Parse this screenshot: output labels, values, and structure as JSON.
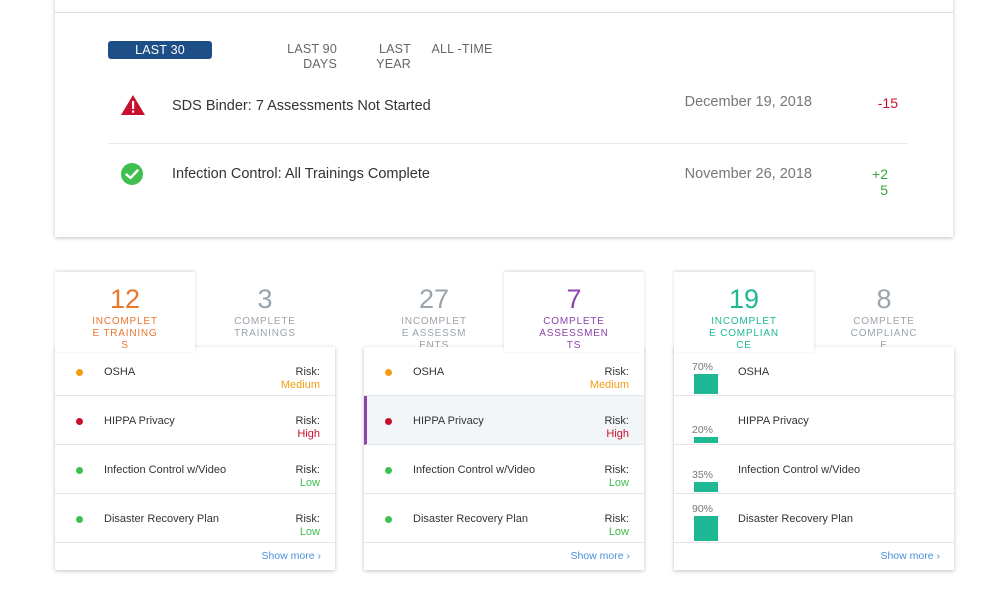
{
  "filters": [
    {
      "label": "LAST 30",
      "active": true
    },
    {
      "label": "LAST 90 DAYS",
      "active": false
    },
    {
      "label": "LAST YEAR",
      "active": false
    },
    {
      "label": "ALL -TIME",
      "active": false
    }
  ],
  "activity": [
    {
      "icon": "warning-icon",
      "text": "SDS Binder: 7 Assessments Not Started",
      "date": "December 19, 2018",
      "delta": "-15"
    },
    {
      "icon": "check-circle-icon",
      "text": "Infection Control: All Trainings Complete",
      "date": "November 26, 2018",
      "delta": "+25"
    }
  ],
  "widgets": {
    "trainings": {
      "tab_left": {
        "count": "12",
        "label": "INCOMPLETE TRAININGS"
      },
      "tab_right": {
        "count": "3",
        "label": "COMPLETE TRAININGS"
      },
      "items": [
        {
          "name": "OSHA",
          "risk_label": "Risk:",
          "risk": "Medium"
        },
        {
          "name": "HIPPA Privacy",
          "risk_label": "Risk:",
          "risk": "High"
        },
        {
          "name": "Infection Control w/Video",
          "risk_label": "Risk:",
          "risk": "Low"
        },
        {
          "name": "Disaster Recovery Plan",
          "risk_label": "Risk:",
          "risk": "Low"
        }
      ],
      "show_more": "Show more ›"
    },
    "assessments": {
      "tab_left": {
        "count": "27",
        "label": "INCOMPLETE ASSESSMENTS"
      },
      "tab_right": {
        "count": "7",
        "label": "COMPLETE ASSESSMENTS"
      },
      "items": [
        {
          "name": "OSHA",
          "risk_label": "Risk:",
          "risk": "Medium"
        },
        {
          "name": "HIPPA Privacy",
          "risk_label": "Risk:",
          "risk": "High"
        },
        {
          "name": "Infection Control w/Video",
          "risk_label": "Risk:",
          "risk": "Low"
        },
        {
          "name": "Disaster Recovery Plan",
          "risk_label": "Risk:",
          "risk": "Low"
        }
      ],
      "show_more": "Show more ›"
    },
    "compliance": {
      "tab_left": {
        "count": "19",
        "label": "INCOMPLETE COMPLIANCE"
      },
      "tab_right": {
        "count": "8",
        "label": "COMPLETE COMPLIANCE"
      },
      "items": [
        {
          "name": "OSHA",
          "percent": "70%",
          "progress": 0.7
        },
        {
          "name": "HIPPA Privacy",
          "percent": "20%",
          "progress": 0.2
        },
        {
          "name": "Infection Control w/Video",
          "percent": "35%",
          "progress": 0.35
        },
        {
          "name": "Disaster Recovery Plan",
          "percent": "90%",
          "progress": 0.9
        }
      ],
      "show_more": "Show more ›"
    }
  },
  "colors": {
    "accent_blue": "#1d4f86",
    "orange": "#e8772e",
    "purple": "#8e44ad",
    "teal": "#1fb895",
    "risk_high": "#c8102e",
    "risk_medium": "#f39c12",
    "risk_low": "#3fbf4f"
  }
}
